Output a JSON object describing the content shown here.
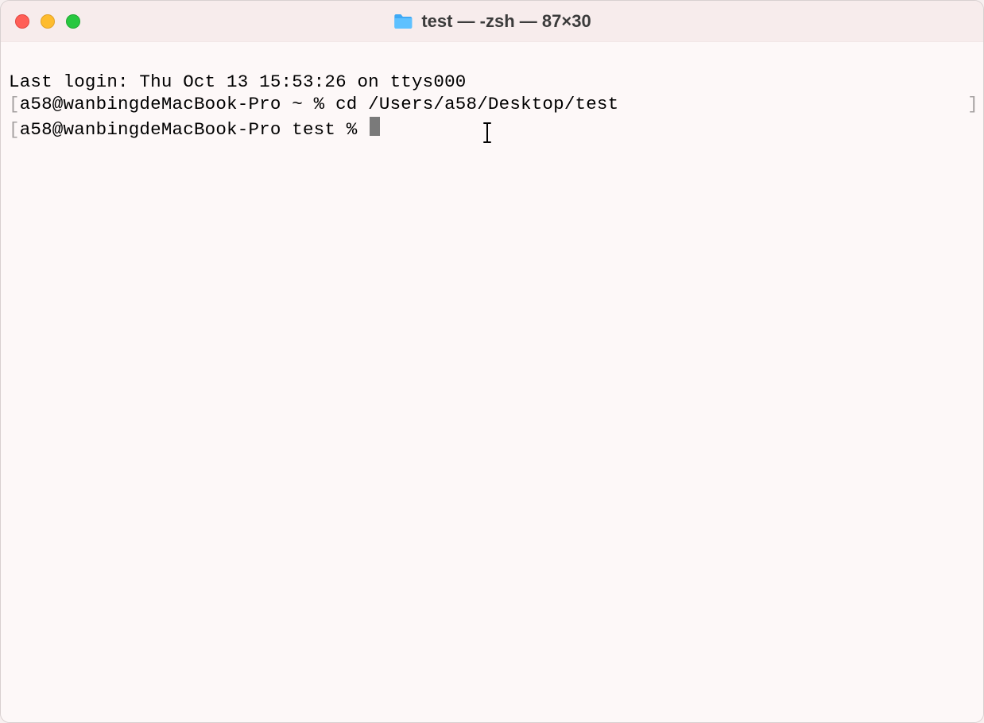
{
  "titlebar": {
    "title": "test — -zsh — 87×30",
    "folder_icon": "folder-icon"
  },
  "traffic_lights": {
    "close": "close",
    "minimize": "minimize",
    "maximize": "maximize"
  },
  "terminal": {
    "last_login": "Last login: Thu Oct 13 15:53:26 on ttys000",
    "line1": {
      "open_bracket": "[",
      "prompt": "a58@wanbingdeMacBook-Pro ~ % ",
      "command": "cd /Users/a58/Desktop/test",
      "close_bracket": "]"
    },
    "line2": {
      "open_bracket": "[",
      "prompt": "a58@wanbingdeMacBook-Pro test % "
    }
  }
}
